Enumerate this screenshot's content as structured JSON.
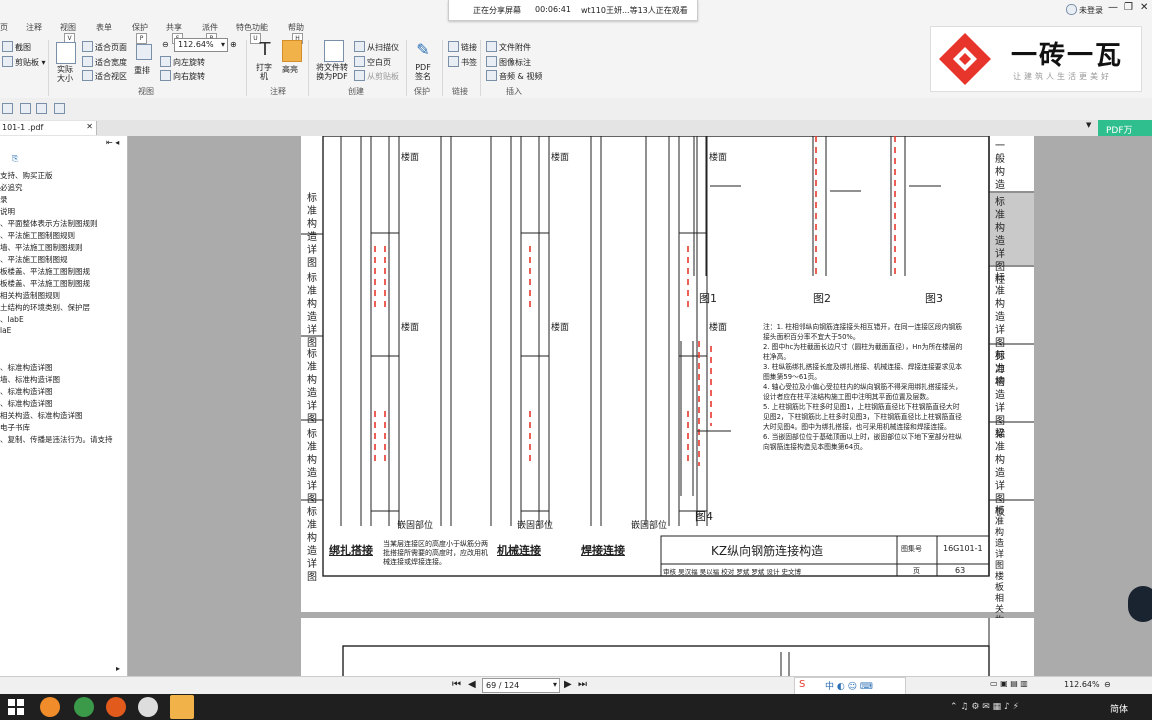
{
  "share_banner": {
    "status": "正在分享屏幕",
    "timer": "00:06:41",
    "viewers": "wt110王妍...等13人正在观看"
  },
  "window": {
    "login": "未登录",
    "menu_tabs": [
      "页",
      "注释",
      "视图",
      "表单",
      "保护",
      "共享",
      "派件",
      "特色功能",
      "帮助"
    ],
    "keytips": [
      "V",
      "P",
      "S",
      "B",
      "U",
      "H",
      "C",
      "D"
    ]
  },
  "ribbon": {
    "screenshot": "截图",
    "clipboard": "剪贴板",
    "actual_size": "实际大小",
    "fit_page": "适合页面",
    "fit_width": "适合宽度",
    "fit_view": "适合视区",
    "zoom_value": "112.64%",
    "reflow": "重排",
    "rotate_left": "向左旋转",
    "rotate_right": "向右旋转",
    "group_view": "视图",
    "typewriter": "打字机",
    "highlight": "高亮",
    "group_comment": "注释",
    "convert": "将文件转换为PDF",
    "from_scanner": "从扫描仪",
    "blank_page": "空白页",
    "from_clipboard": "从剪贴板",
    "group_create": "创建",
    "pdf_sign": "PDF签名",
    "group_protect": "保护",
    "link": "链接",
    "bookmark": "书签",
    "group_links": "链接",
    "file_attach": "文件附件",
    "image_mark": "图像标注",
    "audio_video": "音频 & 视频",
    "group_insert": "插入"
  },
  "doc_tab": {
    "name": "101-1 .pdf",
    "pdf_convert": "PDF万"
  },
  "bookmarks": [
    "支持、购买正版",
    "必追究",
    "录",
    "说明",
    "、平面整体表示方法制图规则",
    "、平法施工图制图规则",
    "墙、平法施工图制图规则",
    "、平法施工图制图规",
    "板楼盖、平法施工图制图规",
    "板楼盖、平法施工图制图规",
    "相关构造制图规则",
    "土结构的环境类别、保护层",
    "、labE",
    "laE",
    "",
    "、标准构造详图",
    "墙、标准构造详图",
    "、标准构造详图",
    "、标准构造详图",
    "相关构造、标准构造详图",
    "电子书库",
    "、复制、传播是违法行为。请支持"
  ],
  "page": {
    "title": "KZ纵向钢筋连接构造",
    "atlas_label": "图集号",
    "atlas_no": "16G101-1",
    "page_label": "页",
    "page_no": "63",
    "sign_row": [
      "审核",
      "吴汉福",
      "吴以福",
      "校对",
      "罗斌",
      "罗斌",
      "设计",
      "史文博",
      "",
      "页"
    ],
    "methods": [
      "绑扎搭接",
      "机械连接",
      "焊接连接"
    ],
    "method_note": "当某层连接区的高度小于纵筋分两批搭接所需要的高度时，应改用机械连接或焊接连接。",
    "floor": "楼面",
    "embed": "嵌固部位",
    "non_conn": "非连接区",
    "notes": [
      "注：1. 柱相邻纵向钢筋连接接头相互错开，在同一连接区段内钢筋接头面积百分率不宜大于50%。",
      "2. 图中hc为柱截面长边尺寸（圆柱为截面直径），Hn为所在楼层的柱净高。",
      "3. 柱纵筋绑扎搭接长度及绑扎搭接、机械连接、焊接连接要求见本图集第59～61页。",
      "4. 轴心受拉及小偏心受拉柱内的纵向钢筋不得采用绑扎搭接接头，设计者应在柱平法结构施工图中注明其平面位置及层数。",
      "5. 上柱钢筋比下柱多时见图1，上柱钢筋直径比下柱钢筋直径大时见图2，下柱钢筋比上柱多时见图3，下柱钢筋直径比上柱钢筋直径大时见图4。图中为绑扎搭接，也可采用机械连接和焊接连接。",
      "6. 当嵌固部位位于基础顶面以上时，嵌固部位以下地下室部分柱纵向钢筋连接构造见本图集第64页。"
    ],
    "figs": [
      "图1",
      "图2",
      "图3",
      "图4"
    ],
    "side_tabs": [
      "一般构造",
      "标准构造详图 柱",
      "标准构造详图 剪力墙",
      "标准构造详图 梁",
      "标准构造详图 板",
      "标准构造详图 楼板相关构造"
    ],
    "side_left": [
      "标准构造详图",
      "标准构造详图",
      "标准构造详图",
      "标准构造详图",
      "标准构造详图"
    ]
  },
  "statusbar": {
    "page_input": "69 / 124",
    "zoom": "112.64%"
  },
  "taskbar": {
    "lang": "简体"
  },
  "logo": {
    "name": "一砖一瓦",
    "slogan": "让建筑人生活更美好"
  },
  "colors": {
    "accent": "#e63a2e",
    "highlight_button": "#f2b24a",
    "logo_red": "#e8352b"
  }
}
